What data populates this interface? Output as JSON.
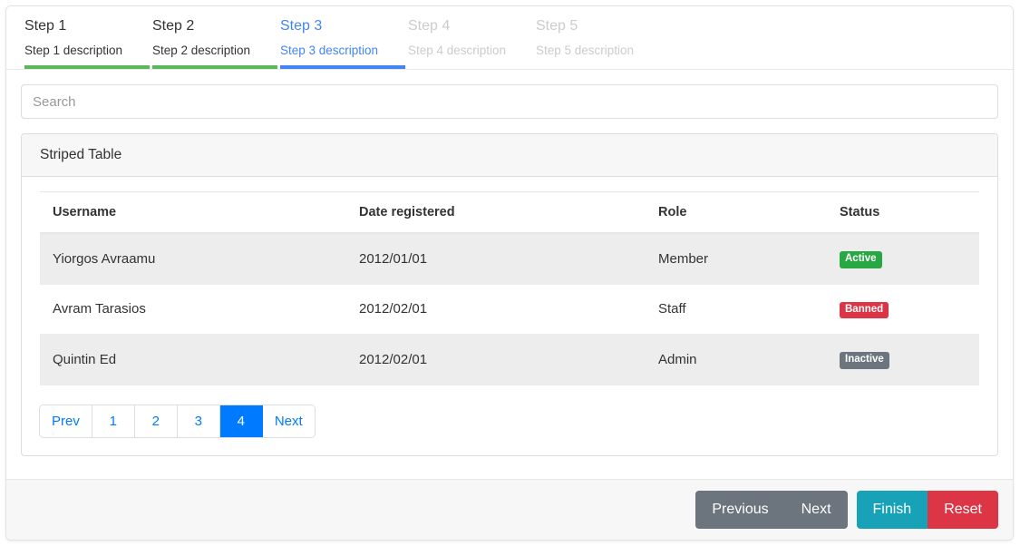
{
  "stepper": {
    "steps": [
      {
        "title": "Step 1",
        "description": "Step 1 description",
        "state": "done"
      },
      {
        "title": "Step 2",
        "description": "Step 2 description",
        "state": "done"
      },
      {
        "title": "Step 3",
        "description": "Step 3 description",
        "state": "active"
      },
      {
        "title": "Step 4",
        "description": "Step 4 description",
        "state": "disabled"
      },
      {
        "title": "Step 5",
        "description": "Step 5 description",
        "state": "disabled"
      }
    ]
  },
  "search": {
    "placeholder": "Search",
    "value": ""
  },
  "card": {
    "title": "Striped Table"
  },
  "table": {
    "columns": [
      "Username",
      "Date registered",
      "Role",
      "Status"
    ],
    "rows": [
      {
        "username": "Yiorgos Avraamu",
        "date_registered": "2012/01/01",
        "role": "Member",
        "status": "Active",
        "status_variant": "success"
      },
      {
        "username": "Avram Tarasios",
        "date_registered": "2012/02/01",
        "role": "Staff",
        "status": "Banned",
        "status_variant": "danger"
      },
      {
        "username": "Quintin Ed",
        "date_registered": "2012/02/01",
        "role": "Admin",
        "status": "Inactive",
        "status_variant": "secondary"
      }
    ]
  },
  "pagination": {
    "prev_label": "Prev",
    "next_label": "Next",
    "pages": [
      "1",
      "2",
      "3",
      "4"
    ],
    "active_page": "4"
  },
  "footer": {
    "previous_label": "Previous",
    "next_label": "Next",
    "finish_label": "Finish",
    "reset_label": "Reset"
  },
  "colors": {
    "step_done": "#5cb85c",
    "step_active": "#4285f4",
    "step_disabled": "#cccccc",
    "badge_success": "#28a745",
    "badge_danger": "#dc3545",
    "badge_secondary": "#6c757d",
    "pagination_active": "#007bff",
    "btn_secondary": "#6c757d",
    "btn_info": "#17a2b8",
    "btn_danger": "#dc3545"
  }
}
